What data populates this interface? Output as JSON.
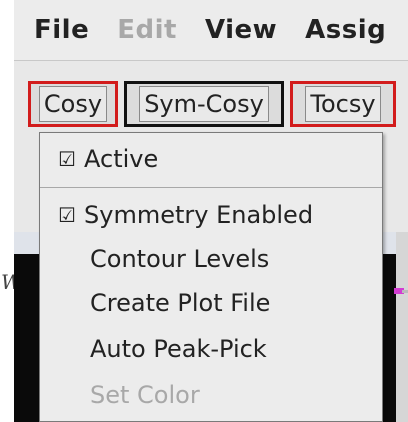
{
  "menubar": {
    "items": [
      {
        "label": "File",
        "enabled": true
      },
      {
        "label": "Edit",
        "enabled": false
      },
      {
        "label": "View",
        "enabled": true
      },
      {
        "label": "Assig",
        "enabled": true
      }
    ]
  },
  "toolbar": {
    "tabs": [
      {
        "label": "Cosy",
        "border": "#d21c1c"
      },
      {
        "label": "Sym-Cosy",
        "border": "#111111"
      },
      {
        "label": "Tocsy",
        "border": "#d21c1c"
      }
    ]
  },
  "context_menu": {
    "items": [
      {
        "label": "Active",
        "checked": true,
        "enabled": true
      },
      {
        "label": "Symmetry Enabled",
        "checked": true,
        "enabled": true
      },
      {
        "label": "Contour Levels",
        "checked": false,
        "enabled": true
      },
      {
        "label": "Create Plot File",
        "checked": false,
        "enabled": true
      },
      {
        "label": "Auto Peak-Pick",
        "checked": false,
        "enabled": true
      },
      {
        "label": "Set Color",
        "checked": false,
        "enabled": false
      }
    ],
    "check_glyph": "☑"
  },
  "left_glyph": "W",
  "colors": {
    "active_border": "#d21c1c",
    "inactive_border": "#111111",
    "disabled_text": "#a8a8a8",
    "plot_background": "#0a0a0a",
    "peak_marker": "#d23cd2"
  }
}
